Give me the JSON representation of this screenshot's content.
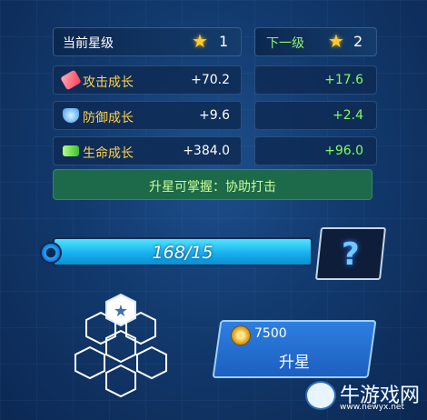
{
  "header": {
    "current_label": "当前星级",
    "current_stars": "1",
    "next_label": "下一级",
    "next_stars": "2"
  },
  "stats": [
    {
      "icon": "attack-icon",
      "label": "攻击成长",
      "value": "+70.2",
      "next": "+17.6",
      "color": "#ff5b70"
    },
    {
      "icon": "defense-icon",
      "label": "防御成长",
      "value": "+9.6",
      "next": "+2.4",
      "color": "#56b7ff"
    },
    {
      "icon": "life-icon",
      "label": "生命成长",
      "value": "+384.0",
      "next": "+96.0",
      "color": "#6be24a"
    }
  ],
  "skill": {
    "text": "升星可掌握：协助打击"
  },
  "progress": {
    "text": "168/15",
    "fill": 1.0
  },
  "upgrade": {
    "cost": "7500",
    "label": "升星"
  },
  "watermark": {
    "name": "牛游戏网",
    "url": "www.newyx.net"
  },
  "colors": {
    "accent": "#1ab0ef",
    "star": "#ffcc33",
    "stat_label": "#ffd34d",
    "next_value": "#7dff5e"
  }
}
